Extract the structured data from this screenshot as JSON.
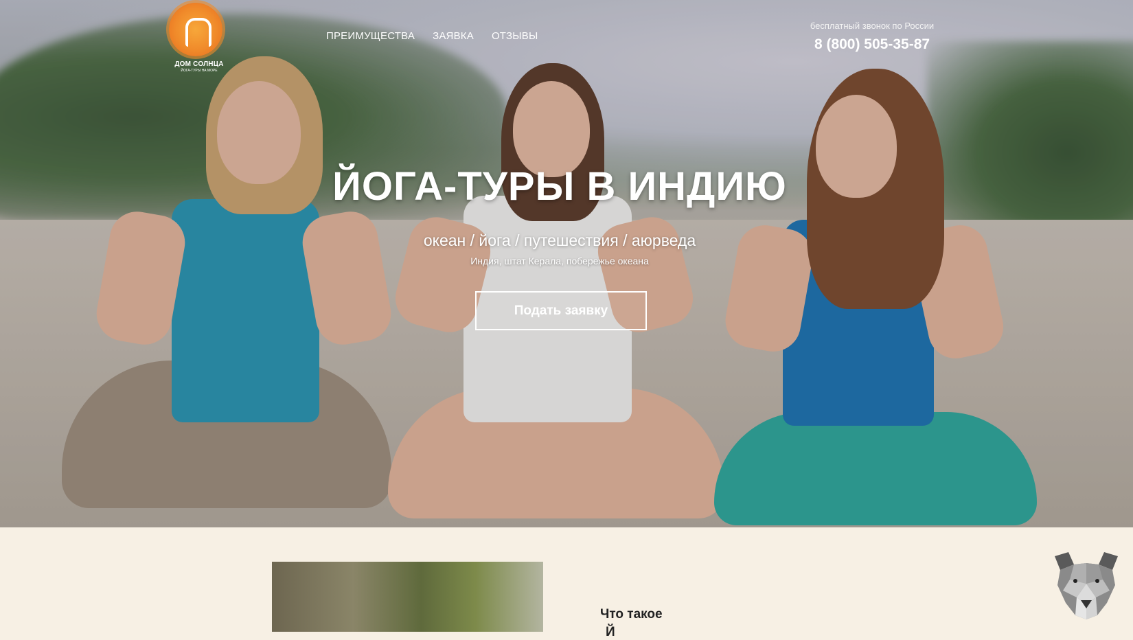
{
  "brand": {
    "name": "ДОМ СОЛНЦА",
    "tagline": "ЙОГА-ТУРЫ НА МОРЕ"
  },
  "nav": {
    "items": [
      "ПРЕИМУЩЕСТВА",
      "ЗАЯВКА",
      "ОТЗЫВЫ"
    ]
  },
  "contact": {
    "caption": "бесплатный звонок по России",
    "phone": "8 (800) 505-35-87"
  },
  "hero": {
    "title": "ЙОГА-ТУРЫ В ИНДИЮ",
    "subtitle": "океан / йога / путешествия / аюрведа",
    "location": "Индия, штат Керала, побережье океана",
    "cta_label": "Подать заявку"
  },
  "section": {
    "heading_line1": "Что такое",
    "heading_line2": "Й"
  },
  "icons": {
    "logo": "sun-logo-icon",
    "bear": "bear-icon"
  },
  "colors": {
    "accent": "#f08a2a",
    "background": "#f7f0e4"
  }
}
